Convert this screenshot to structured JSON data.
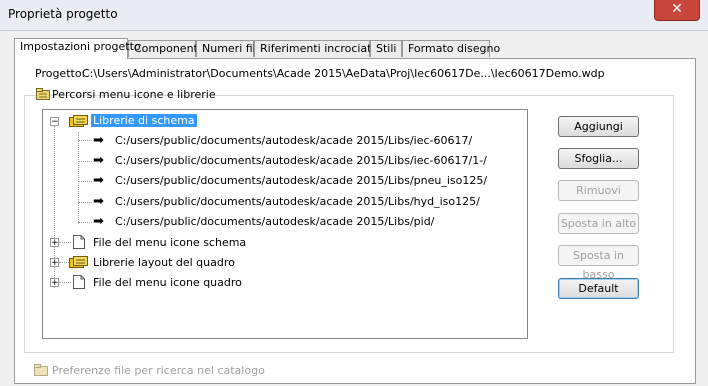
{
  "window": {
    "title": "Proprietà progetto",
    "close_glyph": "✕"
  },
  "tabs": [
    {
      "label": "Impostazioni progetto",
      "active": true
    },
    {
      "label": "Componenti"
    },
    {
      "label": "Numeri fili"
    },
    {
      "label": "Riferimenti incrociati"
    },
    {
      "label": "Stili"
    },
    {
      "label": "Formato disegno"
    }
  ],
  "project": {
    "label": "Progetto:",
    "path": "C:\\Users\\Administrator\\Documents\\Acade 2015\\AeData\\Proj\\Iec60617De...\\Iec60617Demo.wdp"
  },
  "section": {
    "label": "Percorsi menu icone e librerie",
    "icon": "folder-tree-icon"
  },
  "tree": {
    "root": {
      "label": "Librerie di schema",
      "icon": "folder-stack-icon"
    },
    "paths": [
      "C:/users/public/documents/autodesk/acade 2015/Libs/iec-60617/",
      "C:/users/public/documents/autodesk/acade 2015/Libs/iec-60617/1-/",
      "C:/users/public/documents/autodesk/acade 2015/Libs/pneu_iso125/",
      "C:/users/public/documents/autodesk/acade 2015/Libs/hyd_iso125/",
      "C:/users/public/documents/autodesk/acade 2015/Libs/pid/"
    ],
    "nodes": [
      {
        "label": "File del menu icone schema",
        "icon": "document-icon"
      },
      {
        "label": "Librerie layout del quadro",
        "icon": "folder-stack-icon"
      },
      {
        "label": "File del menu icone quadro",
        "icon": "document-icon"
      }
    ]
  },
  "buttons": {
    "add": "Aggiungi",
    "browse": "Sfoglia...",
    "remove": "Rimuovi",
    "move_up": "Sposta in alto",
    "move_down": "Sposta in basso",
    "default": "Default"
  },
  "preferences": {
    "label": "Preferenze file per ricerca nel catalogo"
  },
  "colors": {
    "selection": "#3399ff",
    "close": "#c9463d"
  }
}
